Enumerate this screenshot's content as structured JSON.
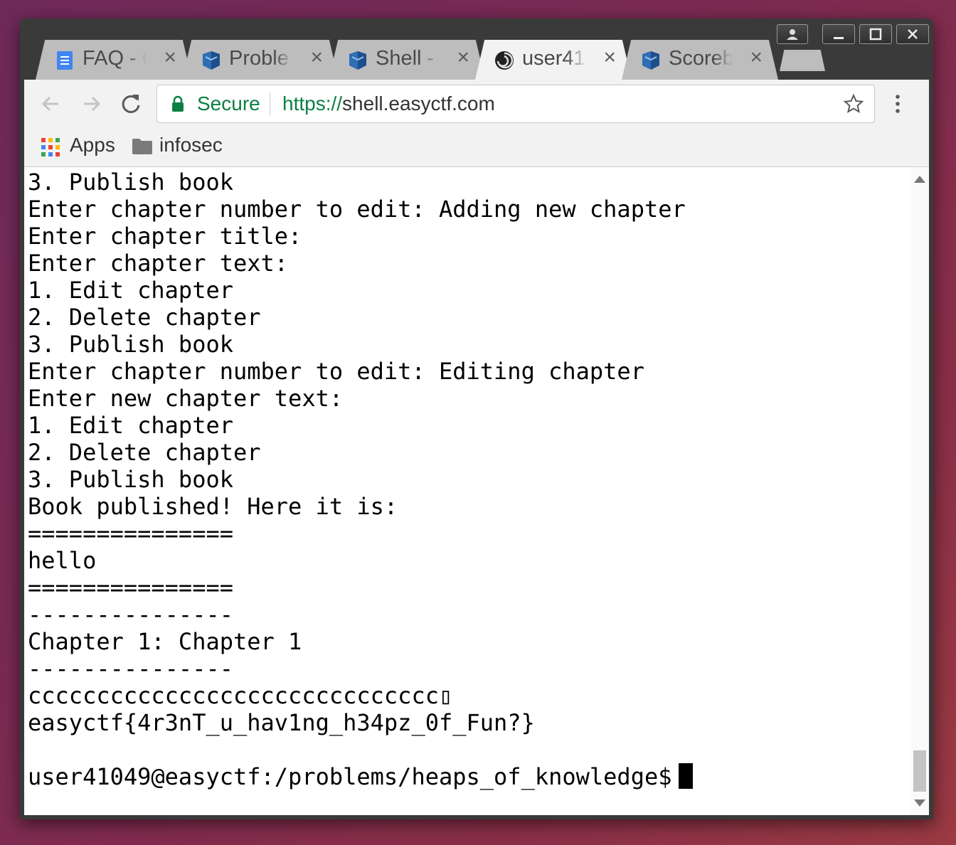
{
  "window_controls": {
    "profile_icon": "person-icon",
    "minimize_icon": "minimize-icon",
    "maximize_icon": "maximize-icon",
    "close_icon": "close-icon"
  },
  "tabs": [
    {
      "label": "FAQ - C",
      "icon": "docs-icon",
      "close": "×"
    },
    {
      "label": "Proble",
      "icon": "shield-icon",
      "close": "×"
    },
    {
      "label": "Shell - (",
      "icon": "shield-icon",
      "close": "×"
    },
    {
      "label": "user41",
      "icon": "swirl-icon",
      "close": "×"
    },
    {
      "label": "Scoreb",
      "icon": "shield-icon",
      "close": "×"
    }
  ],
  "toolbar": {
    "secure_label": "Secure",
    "url_scheme": "https://",
    "url_host": "shell.easyctf.com"
  },
  "bookmarks": [
    {
      "label": "Apps",
      "icon": "apps-grid-icon"
    },
    {
      "label": "infosec",
      "icon": "folder-icon"
    }
  ],
  "terminal": {
    "lines": [
      "3. Publish book",
      "Enter chapter number to edit: Adding new chapter",
      "Enter chapter title:",
      "Enter chapter text:",
      "1. Edit chapter",
      "2. Delete chapter",
      "3. Publish book",
      "Enter chapter number to edit: Editing chapter",
      "Enter new chapter text:",
      "1. Edit chapter",
      "2. Delete chapter",
      "3. Publish book",
      "Book published! Here it is:",
      "===============",
      "hello",
      "===============",
      "---------------",
      "Chapter 1: Chapter 1",
      "---------------",
      "cccccccccccccccccccccccccccccc▯",
      "easyctf{4r3nT_u_hav1ng_h34pz_0f_Fun?}",
      ""
    ],
    "prompt": "user41049@easyctf:/problems/heaps_of_knowledge$"
  },
  "colors": {
    "secure_green": "#0b8043",
    "tab_active": "#f2f2f2",
    "tab_inactive": "#bdbdbd",
    "docs_blue": "#4285f4",
    "shield_blue": "#2f6db5"
  }
}
